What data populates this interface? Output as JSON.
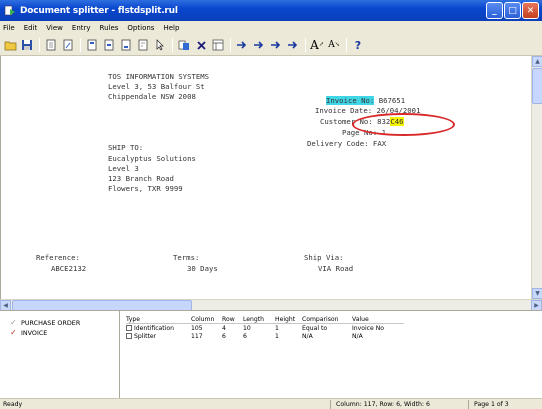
{
  "window": {
    "title": "Document splitter - flstdsplit.rul",
    "buttons": [
      "_",
      "□",
      "✕"
    ]
  },
  "menu": [
    "File",
    "Edit",
    "View",
    "Entry",
    "Rules",
    "Options",
    "Help"
  ],
  "toolbar": {
    "icons": [
      "⬚",
      "▣",
      "🗋",
      "✎",
      "🗎",
      "🗎",
      "🗎",
      "🗎",
      "↳",
      "⧉",
      "✕",
      "⊞",
      "→",
      "→",
      "→",
      "→",
      "A",
      "A",
      "?"
    ]
  },
  "document": {
    "company_lines": [
      "TOS INFORMATION SYSTEMS",
      "Level 3, 53 Balfour St",
      "Chippendale NSW 2008"
    ],
    "invoice_no_label": "Invoice No:",
    "invoice_no_value": "B6765",
    "invoice_no_suffix": "1",
    "invoice_date_label": "Invoice Date:",
    "invoice_date_value": "26/04/2001",
    "customer_no_label": "Customer No:",
    "customer_no_value": "832",
    "customer_no_highlight": "C46",
    "page_label": "Page No:",
    "page_value": "1",
    "delivery_label": "Delivery Code:",
    "delivery_value": "FAX",
    "ship_to_label": "SHIP TO:",
    "ship_to_lines": [
      "Eucalyptus Solutions",
      "Level 3",
      "123 Branch Road",
      "Flowers, TXR 9999"
    ],
    "reference_label": "Reference:",
    "reference_value": "ABCE2132",
    "terms_label": "Terms:",
    "terms_value": "30 Days",
    "ship_via_label": "Ship Via:",
    "ship_via_value": "VIA Road"
  },
  "tree": {
    "items": [
      "PURCHASE ORDER",
      "INVOICE"
    ]
  },
  "grid": {
    "headers": [
      "Type",
      "Column",
      "Row",
      "Length",
      "Height",
      "Comparison",
      "Value"
    ],
    "rows": [
      [
        "Identification",
        "105",
        "4",
        "10",
        "1",
        "Equal to",
        "Invoice No"
      ],
      [
        "Splitter",
        "117",
        "6",
        "6",
        "1",
        "N/A",
        "N/A"
      ]
    ]
  },
  "status": {
    "ready": "Ready",
    "position": "Column: 117, Row: 6, Width: 6",
    "page": "Page 1 of 3"
  }
}
